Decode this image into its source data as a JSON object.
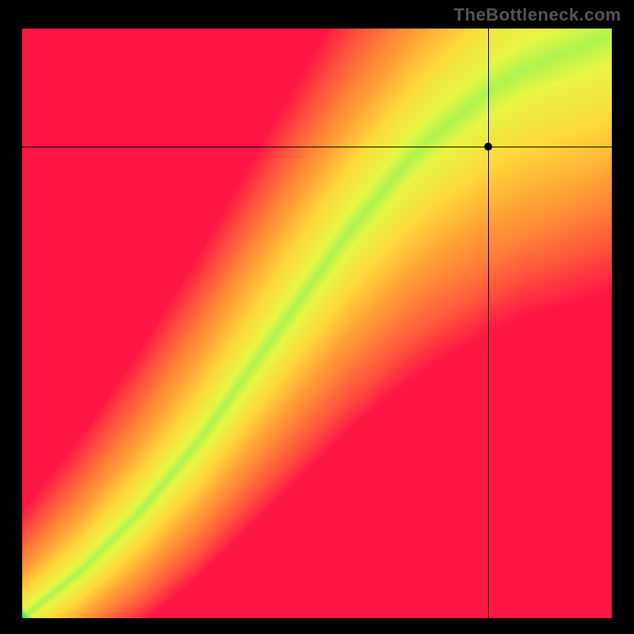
{
  "watermark": "TheBottleneck.com",
  "chart_data": {
    "type": "heatmap",
    "title": "",
    "xlabel": "",
    "ylabel": "",
    "xlim": [
      0,
      100
    ],
    "ylim": [
      0,
      100
    ],
    "legend": false,
    "grid": false,
    "description": "Heatmap showing an optimal diagonal band (green) across a red-orange-yellow gradient field, with a marked operating point near the upper-right intersecting crosshair lines.",
    "marker": {
      "x": 79,
      "y": 80
    },
    "crosshair": {
      "x": 79,
      "y": 80
    },
    "optimal_band": {
      "comment": "The green band follows roughly y = f(x); points near the band are optimal (value ~0), far away approaches 1 (worst).",
      "curve_points_x": [
        0,
        5,
        10,
        15,
        20,
        25,
        30,
        35,
        40,
        45,
        50,
        55,
        60,
        65,
        70,
        75,
        80,
        85,
        90,
        95,
        100
      ],
      "curve_points_y": [
        0,
        4,
        8,
        13,
        18,
        24,
        30,
        37,
        44,
        51,
        58,
        65,
        71,
        77,
        82,
        86,
        90,
        93,
        95,
        97,
        99
      ]
    },
    "color_scale": [
      {
        "value": 0.0,
        "color": "#00e58d"
      },
      {
        "value": 0.12,
        "color": "#7cf35c"
      },
      {
        "value": 0.25,
        "color": "#e6f643"
      },
      {
        "value": 0.4,
        "color": "#ffd83a"
      },
      {
        "value": 0.55,
        "color": "#ffa636"
      },
      {
        "value": 0.7,
        "color": "#ff7a38"
      },
      {
        "value": 0.85,
        "color": "#ff4a3e"
      },
      {
        "value": 1.0,
        "color": "#ff1744"
      }
    ]
  }
}
